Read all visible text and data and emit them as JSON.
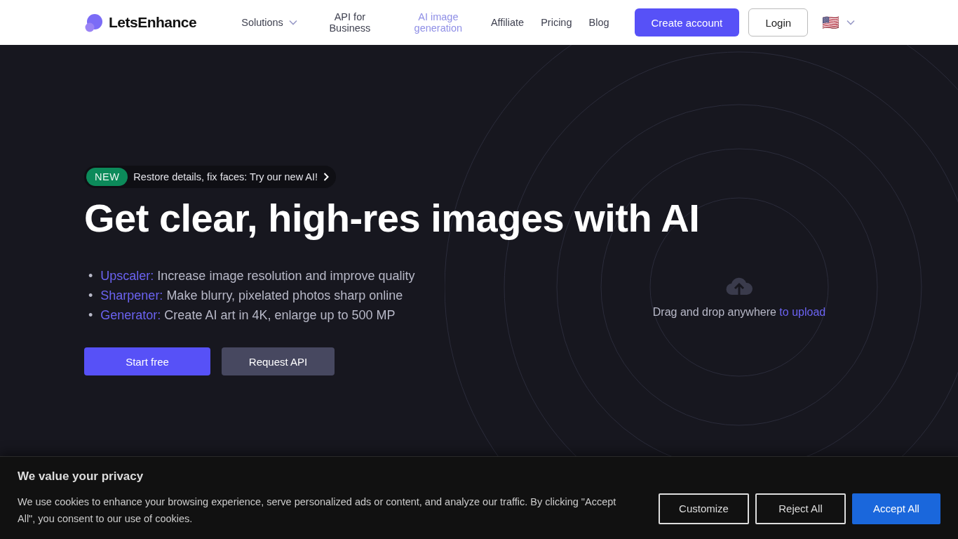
{
  "header": {
    "logo": "LetsEnhance",
    "nav": [
      {
        "label": "Solutions",
        "kind": "dropdown",
        "selected": false
      },
      {
        "label": "API for Business",
        "kind": "link",
        "selected": false
      },
      {
        "label": "AI image generation",
        "kind": "link",
        "selected": true
      },
      {
        "label": "Affiliate",
        "kind": "link",
        "selected": false
      },
      {
        "label": "Pricing",
        "kind": "link",
        "selected": false
      },
      {
        "label": "Blog",
        "kind": "link",
        "selected": false
      }
    ],
    "create_account": "Create account",
    "login": "Login",
    "language_flag": "🇺🇸"
  },
  "hero": {
    "badge": {
      "tag": "NEW",
      "text": "Restore details, fix faces: Try our new AI!"
    },
    "title": "Get clear, high-res images with AI",
    "features": [
      {
        "marker": "•",
        "name": "Upscaler:",
        "text": "Increase image resolution and improve quality"
      },
      {
        "marker": "•",
        "name": "Sharpener:",
        "text": "Make blurry, pixelated photos sharp online"
      },
      {
        "marker": "•",
        "name": "Generator:",
        "text": "Create AI art in 4K, enlarge up to 500 MP"
      }
    ],
    "buttons": [
      {
        "label": "Start free",
        "kind": "primary"
      },
      {
        "label": "Request API",
        "kind": "secondary"
      }
    ],
    "upload": {
      "text": "Drag and drop anywhere",
      "link": "to upload"
    }
  },
  "cookie_banner": {
    "title": "We value your privacy",
    "text": "We use cookies to enhance your browsing experience, serve personalized ads or content, and analyze our traffic. By clicking \"Accept All\", you consent to our use of cookies.",
    "buttons": [
      {
        "label": "Customize",
        "kind": "outline"
      },
      {
        "label": "Reject All",
        "kind": "outline"
      },
      {
        "label": "Accept All",
        "kind": "primary"
      }
    ]
  }
}
